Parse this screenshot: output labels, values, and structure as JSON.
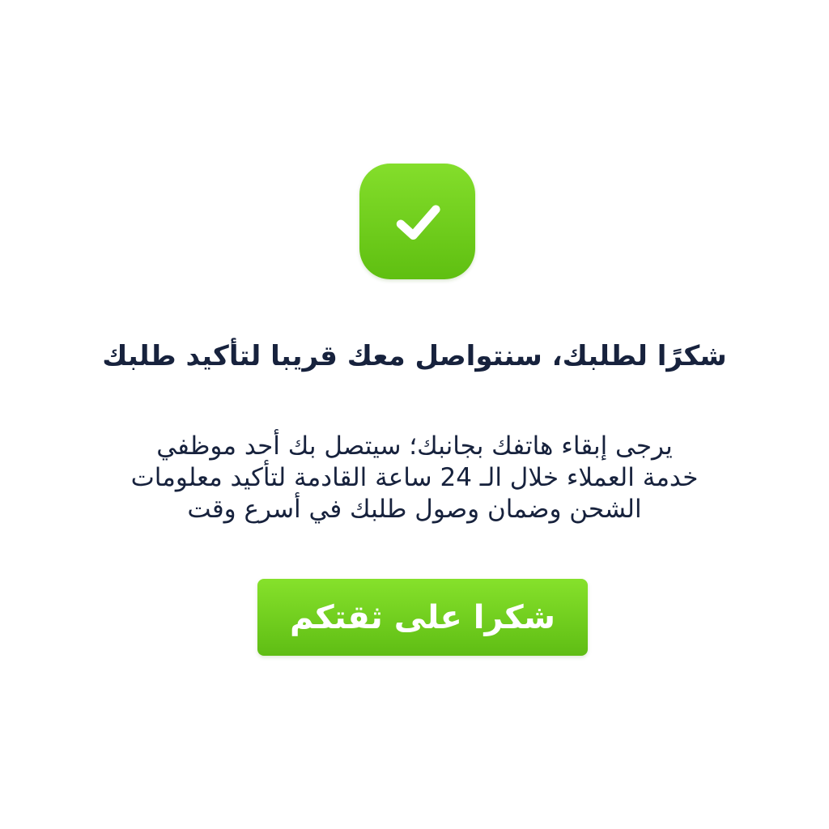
{
  "status_icon": "checkmark-icon",
  "title": "شكرًا لطلبك، سنتواصل معك قريبا لتأكيد طلبك",
  "message_lines": [
    "يرجى إبقاء هاتفك بجانبك؛ سيتصل بك أحد موظفي",
    "خدمة العملاء خلال الـ 24 ساعة القادمة لتأكيد معلومات",
    "الشحن وضمان وصول طلبك في أسرع وقت"
  ],
  "button_label": "شكرا على ثقتكم",
  "colors": {
    "accent_green": "#6fcf1d",
    "text_navy": "#17223d",
    "background": "#ffffff"
  }
}
